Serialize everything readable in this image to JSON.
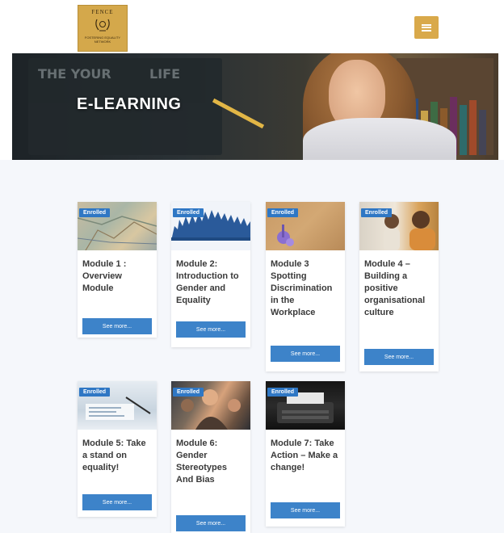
{
  "header": {
    "logo_top": "FENCE",
    "logo_bottom": "FOSTERING EQUALITY NETWORK",
    "menu_icon": "hamburger-icon"
  },
  "hero": {
    "title": "E-LEARNING",
    "chalk_words": [
      "THE YOUR",
      "LIFE"
    ]
  },
  "colors": {
    "accent_gold": "#d9a94a",
    "badge_blue": "#2f77c4",
    "button_blue": "#3d83c9",
    "content_bg": "#f5f7fb"
  },
  "modules": [
    {
      "badge": "Enrolled",
      "title": "Module 1 : Overview Module",
      "button": "See more..."
    },
    {
      "badge": "Enrolled",
      "title": "Module 2: Introduction to Gender and Equality",
      "button": "See more..."
    },
    {
      "badge": "Enrolled",
      "title": "Module 3 Spotting Discrimination in the Workplace",
      "button": "See more..."
    },
    {
      "badge": "Enrolled",
      "title": "Module 4 – Building a positive organisational culture",
      "button": "See more..."
    },
    {
      "badge": "Enrolled",
      "title": "Module 5: Take a stand on equality!",
      "button": "See more..."
    },
    {
      "badge": "Enrolled",
      "title": "Module 6: Gender Stereotypes And Bias",
      "button": "See more..."
    },
    {
      "badge": "Enrolled",
      "title": "Module 7: Take Action – Make a change!",
      "button": "See more..."
    }
  ]
}
